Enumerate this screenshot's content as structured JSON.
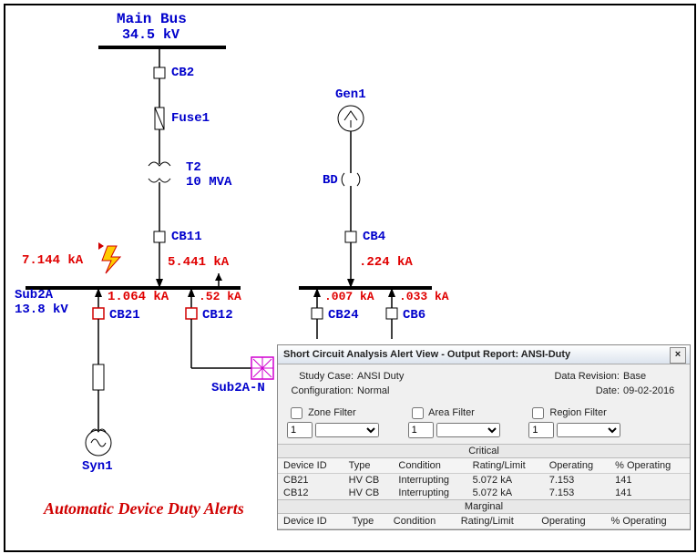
{
  "main_bus": {
    "name": "Main Bus",
    "kv": "34.5 kV"
  },
  "cb2": "CB2",
  "fuse1": "Fuse1",
  "t2": {
    "name": "T2",
    "mva": "10 MVA"
  },
  "cb11": "CB11",
  "fault_ka": "7.144 kA",
  "i_cb11": "5.441 kA",
  "sub2a": {
    "name": "Sub2A",
    "kv": "13.8 kV"
  },
  "i_cb21": "1.064 kA",
  "i_cb12": ".52 kA",
  "cb21": "CB21",
  "cb12": "CB12",
  "sub2a_n": "Sub2A-N",
  "syn1": "Syn1",
  "gen1": "Gen1",
  "bd": "BD",
  "cb4": "CB4",
  "i_cb4": ".224 kA",
  "i_cb24": ".007 kA",
  "i_cb6": ".033 kA",
  "cb24": "CB24",
  "cb6": "CB6",
  "title": "Automatic Device Duty Alerts",
  "alert": {
    "window_title": "Short Circuit Analysis Alert View - Output Report: ANSI-Duty",
    "study_case_lbl": "Study Case:",
    "study_case": "ANSI Duty",
    "config_lbl": "Configuration:",
    "config": "Normal",
    "data_rev_lbl": "Data Revision:",
    "data_rev": "Base",
    "date_lbl": "Date:",
    "date": "09-02-2016",
    "zone_filter": "Zone Filter",
    "area_filter": "Area Filter",
    "region_filter": "Region Filter",
    "one": "1",
    "critical": "Critical",
    "marginal": "Marginal",
    "cols": {
      "device": "Device ID",
      "type": "Type",
      "cond": "Condition",
      "rating": "Rating/Limit",
      "oper": "Operating",
      "pct": "% Operating"
    },
    "rows": [
      {
        "device": "CB21",
        "type": "HV CB",
        "cond": "Interrupting",
        "rating": "5.072 kA",
        "oper": "7.153",
        "pct": "141"
      },
      {
        "device": "CB12",
        "type": "HV CB",
        "cond": "Interrupting",
        "rating": "5.072 kA",
        "oper": "7.153",
        "pct": "141"
      }
    ]
  }
}
